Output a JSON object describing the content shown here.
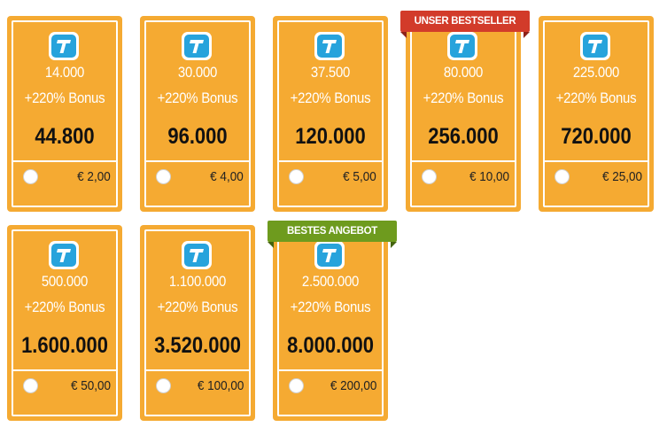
{
  "packages": [
    {
      "coins": "14.000",
      "bonus": "+220% Bonus",
      "total": "44.800",
      "price": "€  2,00"
    },
    {
      "coins": "30.000",
      "bonus": "+220% Bonus",
      "total": "96.000",
      "price": "€  4,00"
    },
    {
      "coins": "37.500",
      "bonus": "+220% Bonus",
      "total": "120.000",
      "price": "€  5,00"
    },
    {
      "coins": "80.000",
      "bonus": "+220% Bonus",
      "total": "256.000",
      "price": "€  10,00"
    },
    {
      "coins": "225.000",
      "bonus": "+220% Bonus",
      "total": "720.000",
      "price": "€  25,00"
    },
    {
      "coins": "500.000",
      "bonus": "+220% Bonus",
      "total": "1.600.000",
      "price": "€  50,00"
    },
    {
      "coins": "1.100.000",
      "bonus": "+220% Bonus",
      "total": "3.520.000",
      "price": "€  100,00"
    },
    {
      "coins": "2.500.000",
      "bonus": "+220% Bonus",
      "total": "8.000.000",
      "price": "€  200,00"
    }
  ],
  "ribbons": {
    "bestseller": "UNSER BESTSELLER",
    "best_offer": "BESTES ANGEBOT"
  },
  "colors": {
    "card": "#f5aa32",
    "logo": "#27a3dc",
    "bestseller_ribbon": "#d23b2a",
    "best_offer_ribbon": "#6e9b1e"
  },
  "icons": {
    "logo": "t-coin-icon",
    "select": "radio-circle"
  }
}
